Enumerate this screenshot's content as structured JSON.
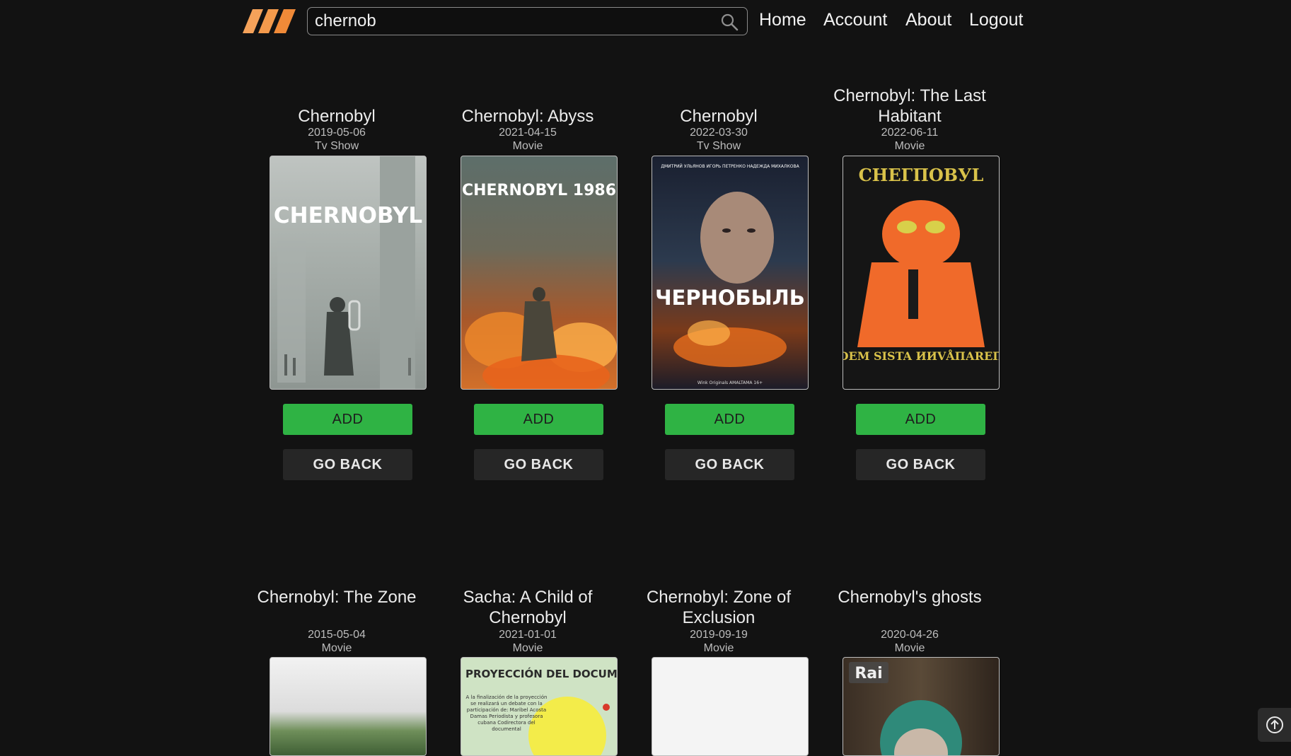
{
  "header": {
    "logo_icon": "brand-stripes-logo",
    "search": {
      "value": "chernob",
      "placeholder": "",
      "icon": "search-icon"
    },
    "nav": {
      "home": "Home",
      "account": "Account",
      "about": "About",
      "logout": "Logout"
    }
  },
  "results": [
    {
      "title": "Chernobyl",
      "date": "2019-05-06",
      "type": "Tv Show",
      "poster_text": "CHERNOBYL",
      "add": "ADD",
      "back": "GO BACK"
    },
    {
      "title": "Chernobyl: Abyss",
      "date": "2021-04-15",
      "type": "Movie",
      "poster_text": "CHERNOBYL 1986",
      "add": "ADD",
      "back": "GO BACK"
    },
    {
      "title": "Chernobyl",
      "date": "2022-03-30",
      "type": "Tv Show",
      "poster_text": "ЧЕРНОБЫЛЬ",
      "poster_top": "ДМИТРИЙ УЛЬЯНОВ    ИГОРЬ ПЕТРЕНКО    НАДЕЖДА МИХАЛКОВА",
      "poster_bottom": "Wink Originals   AMALTAMA   16+",
      "add": "ADD",
      "back": "GO BACK"
    },
    {
      "title": "Chernobyl: The Last Habitant",
      "date": "2022-06-11",
      "type": "Movie",
      "poster_text": "CHEГПОВУL",
      "poster_bottom": "DEM SISTA ИИVÅПАRЕП",
      "add": "ADD",
      "back": "GO BACK"
    },
    {
      "title": "Chernobyl: The Zone",
      "date": "2015-05-04",
      "type": "Movie"
    },
    {
      "title": "Sacha: A Child of Chernobyl",
      "date": "2021-01-01",
      "type": "Movie",
      "poster_text": "PROYECCIÓN DEL DOCUMENTAL",
      "poster_sub": "A la finalización de la proyección se realizará un debate con la participación de: Maribel Acosta Damas Periodista y profesora cubana Codirectora del documental"
    },
    {
      "title": "Chernobyl: Zone of Exclusion",
      "date": "2019-09-19",
      "type": "Movie"
    },
    {
      "title": "Chernobyl's ghosts",
      "date": "2020-04-26",
      "type": "Movie",
      "poster_text": "Rai"
    }
  ],
  "scroll_top_icon": "arrow-up-circle-icon",
  "colors": {
    "background": "#121212",
    "add_button": "#2fb344",
    "back_button": "#262626",
    "logo": "#f39a4c"
  }
}
